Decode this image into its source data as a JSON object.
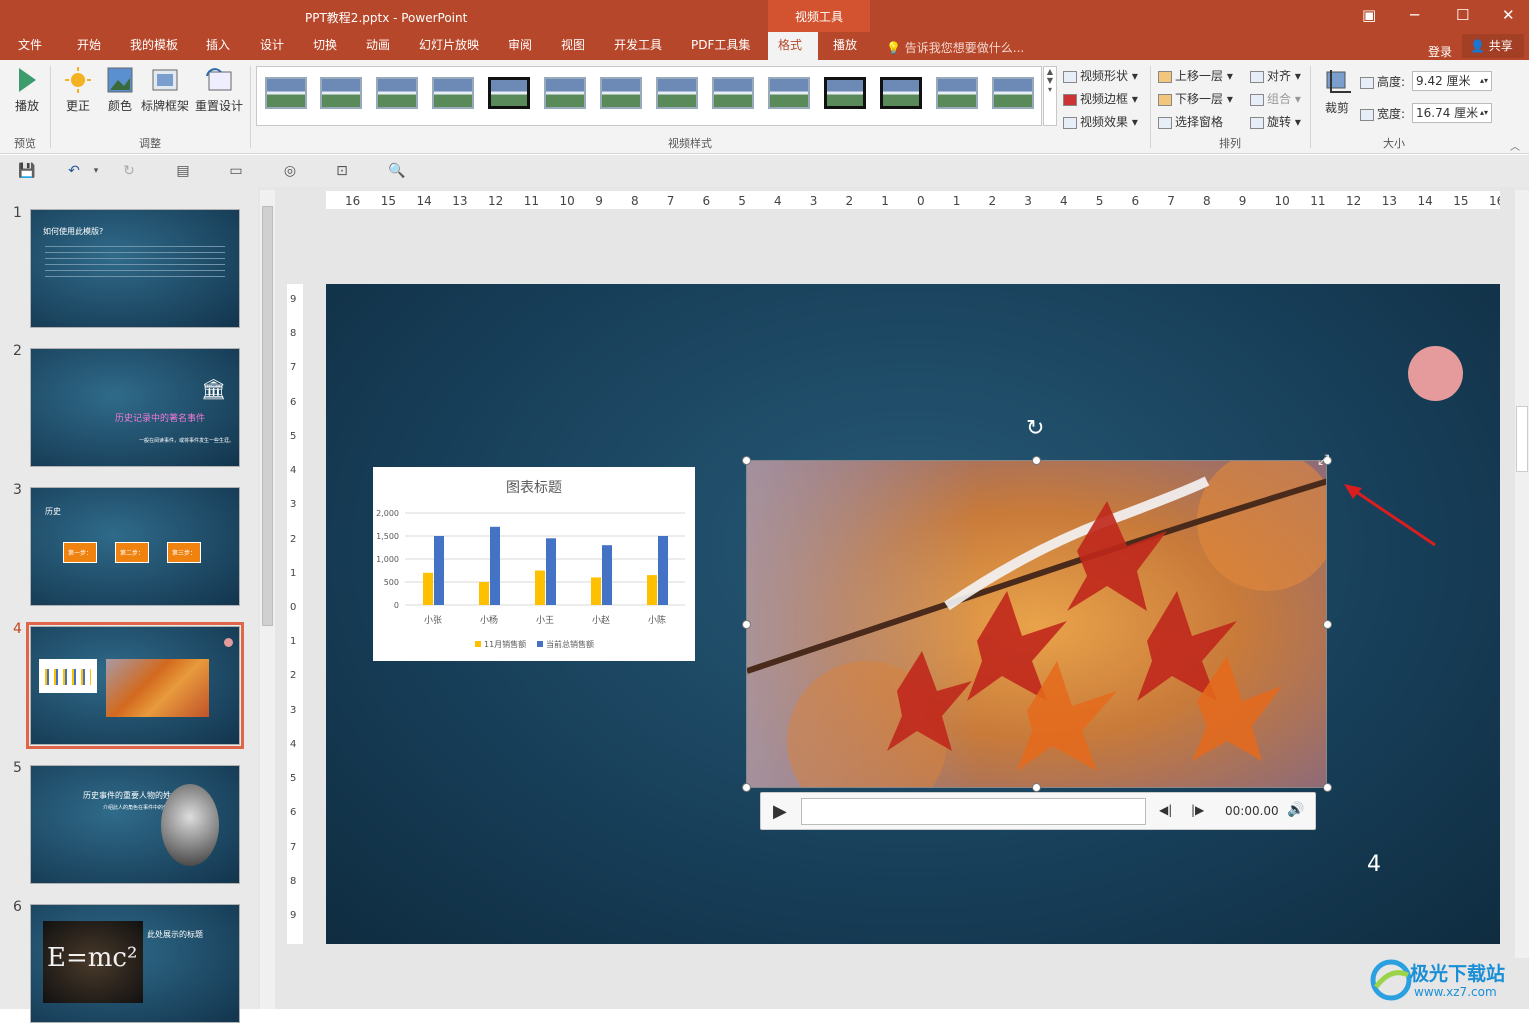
{
  "window": {
    "title": "PPT教程2.pptx - PowerPoint",
    "context_tab": "视频工具"
  },
  "tabs": [
    "文件",
    "开始",
    "我的模板",
    "插入",
    "设计",
    "切换",
    "动画",
    "幻灯片放映",
    "审阅",
    "视图",
    "开发工具",
    "PDF工具集",
    "格式",
    "播放"
  ],
  "active_tab": "格式",
  "tell_me": "告诉我您想要做什么...",
  "account": {
    "login": "登录",
    "share": "共享"
  },
  "ribbon": {
    "play": "播放",
    "group_preview": "预览",
    "adjust_items": [
      "更正",
      "颜色",
      "标牌框架",
      "重置设计"
    ],
    "group_adjust": "调整",
    "group_video_styles": "视频样式",
    "video_menu": [
      "视频形状",
      "视频边框",
      "视频效果"
    ],
    "arrange_col1": [
      "上移一层",
      "下移一层",
      "选择窗格"
    ],
    "arrange_col2": [
      "对齐",
      "组合",
      "旋转"
    ],
    "group_arrange": "排列",
    "crop": "裁剪",
    "height_label": "高度:",
    "height_value": "9.42 厘米",
    "width_label": "宽度:",
    "width_value": "16.74 厘米",
    "group_size": "大小"
  },
  "colors": {
    "accent": "#b7472a",
    "selected_thumb": "#e0664a",
    "bar_orange": "#ffc000",
    "bar_blue": "#4472c4",
    "pink_circle": "#e59a9c"
  },
  "ruler_h": [
    "16",
    "15",
    "14",
    "13",
    "12",
    "11",
    "10",
    "9",
    "8",
    "7",
    "6",
    "5",
    "4",
    "3",
    "2",
    "1",
    "0",
    "1",
    "2",
    "3",
    "4",
    "5",
    "6",
    "7",
    "8",
    "9",
    "10",
    "11",
    "12",
    "13",
    "14",
    "15",
    "16"
  ],
  "thumbnails": [
    {
      "num": "1",
      "title": "如何使用此模版?"
    },
    {
      "num": "2",
      "title": "历史记录中的著名事件",
      "subtitle": "一般在阅读事件，或将事件发生一些生涯。"
    },
    {
      "num": "3",
      "title": "历史",
      "steps": [
        "第一步：",
        "第二步：",
        "第三步："
      ]
    },
    {
      "num": "4"
    },
    {
      "num": "5",
      "title": "历史事件的重要人物的姓名",
      "subtitle": "介绍此人的角色在事件中的作用。"
    },
    {
      "num": "6",
      "title": "此处展示的标题",
      "formula": "E=mc²"
    }
  ],
  "chart_data": {
    "type": "bar",
    "title": "图表标题",
    "categories": [
      "小张",
      "小杨",
      "小王",
      "小赵",
      "小陈"
    ],
    "series": [
      {
        "name": "11月销售额",
        "values": [
          700,
          500,
          750,
          600,
          650
        ]
      },
      {
        "name": "当前总销售额",
        "values": [
          1500,
          1700,
          1450,
          1300,
          1500
        ]
      }
    ],
    "yticks": [
      "2,000",
      "1,500",
      "1,000",
      "500",
      "0"
    ],
    "ylim": [
      0,
      2000
    ],
    "legend": "bottom"
  },
  "video": {
    "time": "00:00.00"
  },
  "slide_number": "4",
  "watermark": {
    "brand": "极光下载站",
    "url": "www.xz7.com"
  }
}
